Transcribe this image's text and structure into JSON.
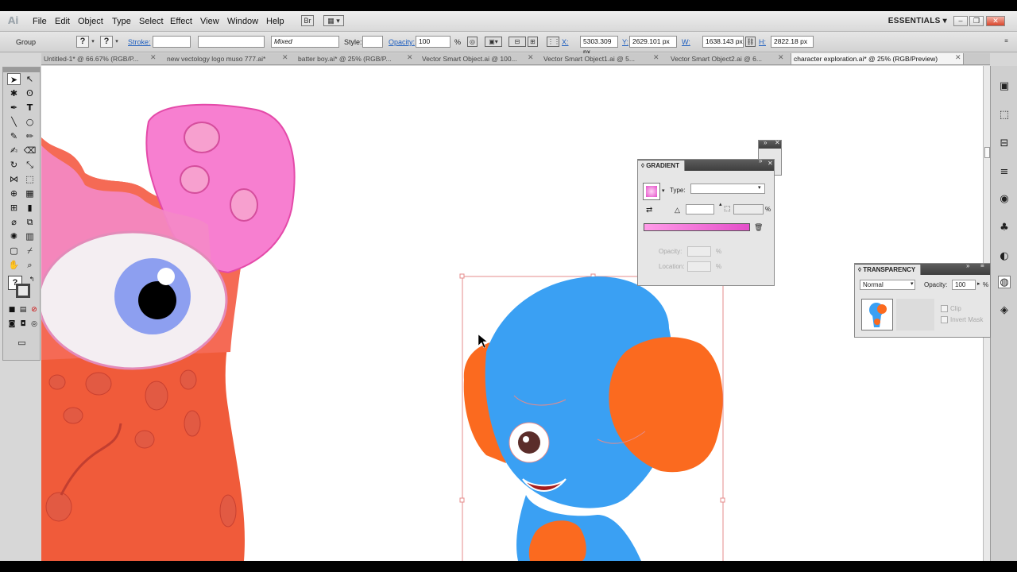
{
  "menubar": {
    "app_logo": "Ai",
    "items": [
      "File",
      "Edit",
      "Object",
      "Type",
      "Select",
      "Effect",
      "View",
      "Window",
      "Help"
    ],
    "workspace": "ESSENTIALS",
    "window_buttons": [
      "–",
      "❐",
      "✕"
    ]
  },
  "controlbar": {
    "selection_label": "Group",
    "stroke_label": "Stroke:",
    "stroke_value": "",
    "brush_value": "Mixed",
    "style_label": "Style:",
    "opacity_label": "Opacity:",
    "opacity_value": "100",
    "opacity_unit": "%",
    "x_label": "X:",
    "x_value": "5303.309 px",
    "y_label": "Y:",
    "y_value": "2629.101 px",
    "w_label": "W:",
    "w_value": "1638.143 px",
    "h_label": "H:",
    "h_value": "2822.18 px"
  },
  "tabs": [
    {
      "label": "Untitled-1* @ 66.67% (RGB/P...",
      "active": false
    },
    {
      "label": "new vectology logo muso 777.ai*",
      "active": false
    },
    {
      "label": "batter boy.ai* @ 25% (RGB/P...",
      "active": false
    },
    {
      "label": "Vector Smart Object.ai @ 100...",
      "active": false
    },
    {
      "label": "Vector Smart Object1.ai @ 5...",
      "active": false
    },
    {
      "label": "Vector Smart Object2.ai @ 6...",
      "active": false
    },
    {
      "label": "character exploration.ai* @ 25% (RGB/Preview)",
      "active": true
    }
  ],
  "gradient_panel": {
    "title": "GRADIENT",
    "type_label": "Type:",
    "type_value": "",
    "angle_unit": "%",
    "opacity_label": "Opacity:",
    "location_label": "Location:",
    "dim_unit": "%",
    "gradient_start": "#ff9be8",
    "gradient_end": "#e44ec9"
  },
  "transparency_panel": {
    "title": "TRANSPARENCY",
    "blend_mode": "Normal",
    "opacity_label": "Opacity:",
    "opacity_value": "100",
    "opacity_unit": "%",
    "clip_label": "Clip",
    "invert_mask_label": "Invert Mask"
  },
  "colors": {
    "character_blue": "#3aa0f3",
    "character_orange": "#fb6a1f",
    "monster_pink": "#f77fd0",
    "monster_red": "#f05b3a",
    "selection_outline": "#e05a5a"
  }
}
